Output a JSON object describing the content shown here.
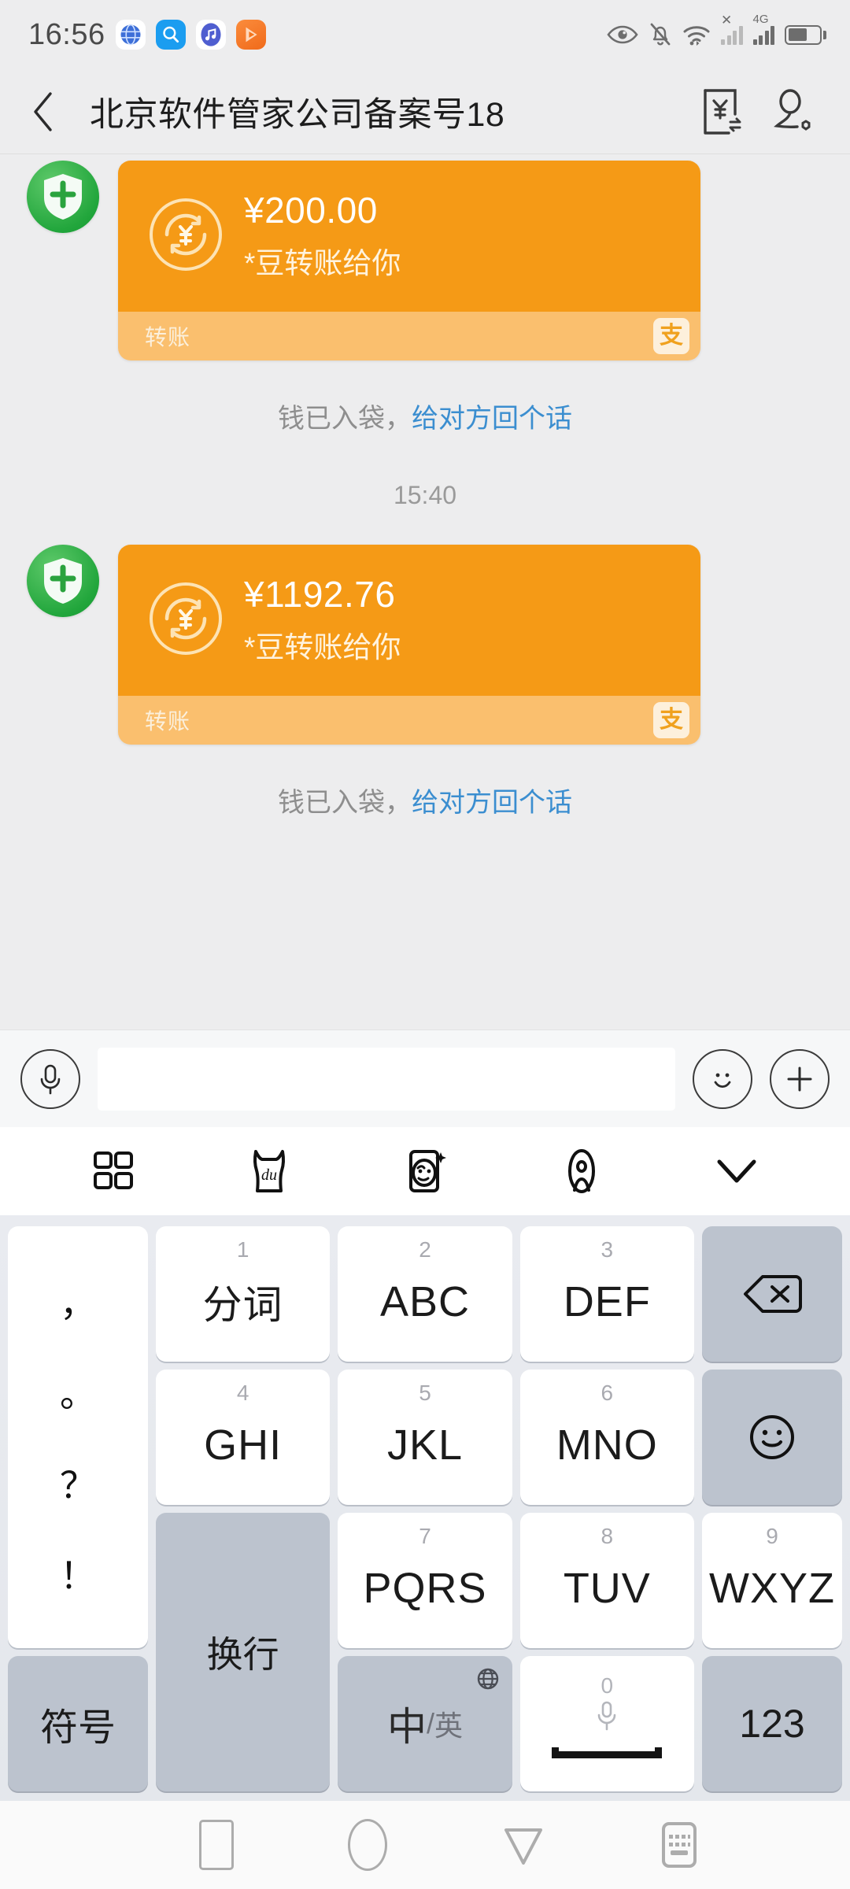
{
  "status_bar": {
    "time": "16:56",
    "left_icons": [
      "globe-icon",
      "search-icon",
      "music-icon",
      "video-icon"
    ],
    "right_icons": [
      "eye-icon",
      "bell-muted-icon",
      "wifi-icon",
      "signal-no-service-icon",
      "signal-4g-icon",
      "battery-icon"
    ],
    "network_label": "4G"
  },
  "header": {
    "back_icon": "chevron-left-icon",
    "title": "北京软件管家公司备案号18",
    "transfer_icon": "yen-transfer-icon",
    "profile_icon": "contact-profile-icon"
  },
  "chat": {
    "messages": [
      {
        "avatar": "shield-plus-avatar",
        "amount": "¥200.00",
        "note": "*豆转账给你",
        "footer_label": "转账",
        "badge": "支",
        "status_prefix": "钱已入袋，",
        "status_link": "给对方回个话"
      },
      {
        "timestamp": "15:40",
        "avatar": "shield-plus-avatar",
        "amount": "¥1192.76",
        "note": "*豆转账给你",
        "footer_label": "转账",
        "badge": "支",
        "status_prefix": "钱已入袋，",
        "status_link": "给对方回个话"
      }
    ]
  },
  "input_bar": {
    "voice_icon": "microphone-icon",
    "field_value": "",
    "field_placeholder": "",
    "emoji_icon": "smiley-icon",
    "more_icon": "plus-icon"
  },
  "keyboard": {
    "toolbar": [
      "grid-apps-icon",
      "baidu-du-icon",
      "sticker-face-icon",
      "person-voice-icon",
      "chevron-down-icon"
    ],
    "punct_key": {
      "name": "punctuation-key",
      "marks": [
        "，",
        "。",
        "？",
        "！"
      ]
    },
    "rows": [
      [
        {
          "num": "1",
          "label": "分词",
          "type": "cjk"
        },
        {
          "num": "2",
          "label": "ABC",
          "type": "latin"
        },
        {
          "num": "3",
          "label": "DEF",
          "type": "latin"
        }
      ],
      [
        {
          "num": "4",
          "label": "GHI",
          "type": "latin"
        },
        {
          "num": "5",
          "label": "JKL",
          "type": "latin"
        },
        {
          "num": "6",
          "label": "MNO",
          "type": "latin"
        }
      ],
      [
        {
          "num": "7",
          "label": "PQRS",
          "type": "latin"
        },
        {
          "num": "8",
          "label": "TUV",
          "type": "latin"
        },
        {
          "num": "9",
          "label": "WXYZ",
          "type": "latin"
        }
      ]
    ],
    "right_keys": {
      "backspace_icon": "backspace-icon",
      "emoji_icon": "smiley-icon",
      "enter_label": "换行"
    },
    "bottom_row": {
      "symbols_label": "符号",
      "lang_primary": "中",
      "lang_separator": "/",
      "lang_secondary": "英",
      "globe_icon": "globe-icon",
      "space_zero": "0",
      "space_mic_icon": "microphone-icon",
      "numbers_label": "123"
    }
  },
  "nav_bar": {
    "recents_icon": "recents-square-icon",
    "home_icon": "home-circle-icon",
    "back_icon": "back-triangle-icon",
    "keyboard_icon": "keyboard-toggle-icon"
  },
  "colors": {
    "bubble_orange": "#f59a16",
    "bubble_footer": "#fabf6e",
    "link_blue": "#3b8ed0",
    "avatar_green": "#22a63c",
    "chat_bg": "#ededee"
  }
}
